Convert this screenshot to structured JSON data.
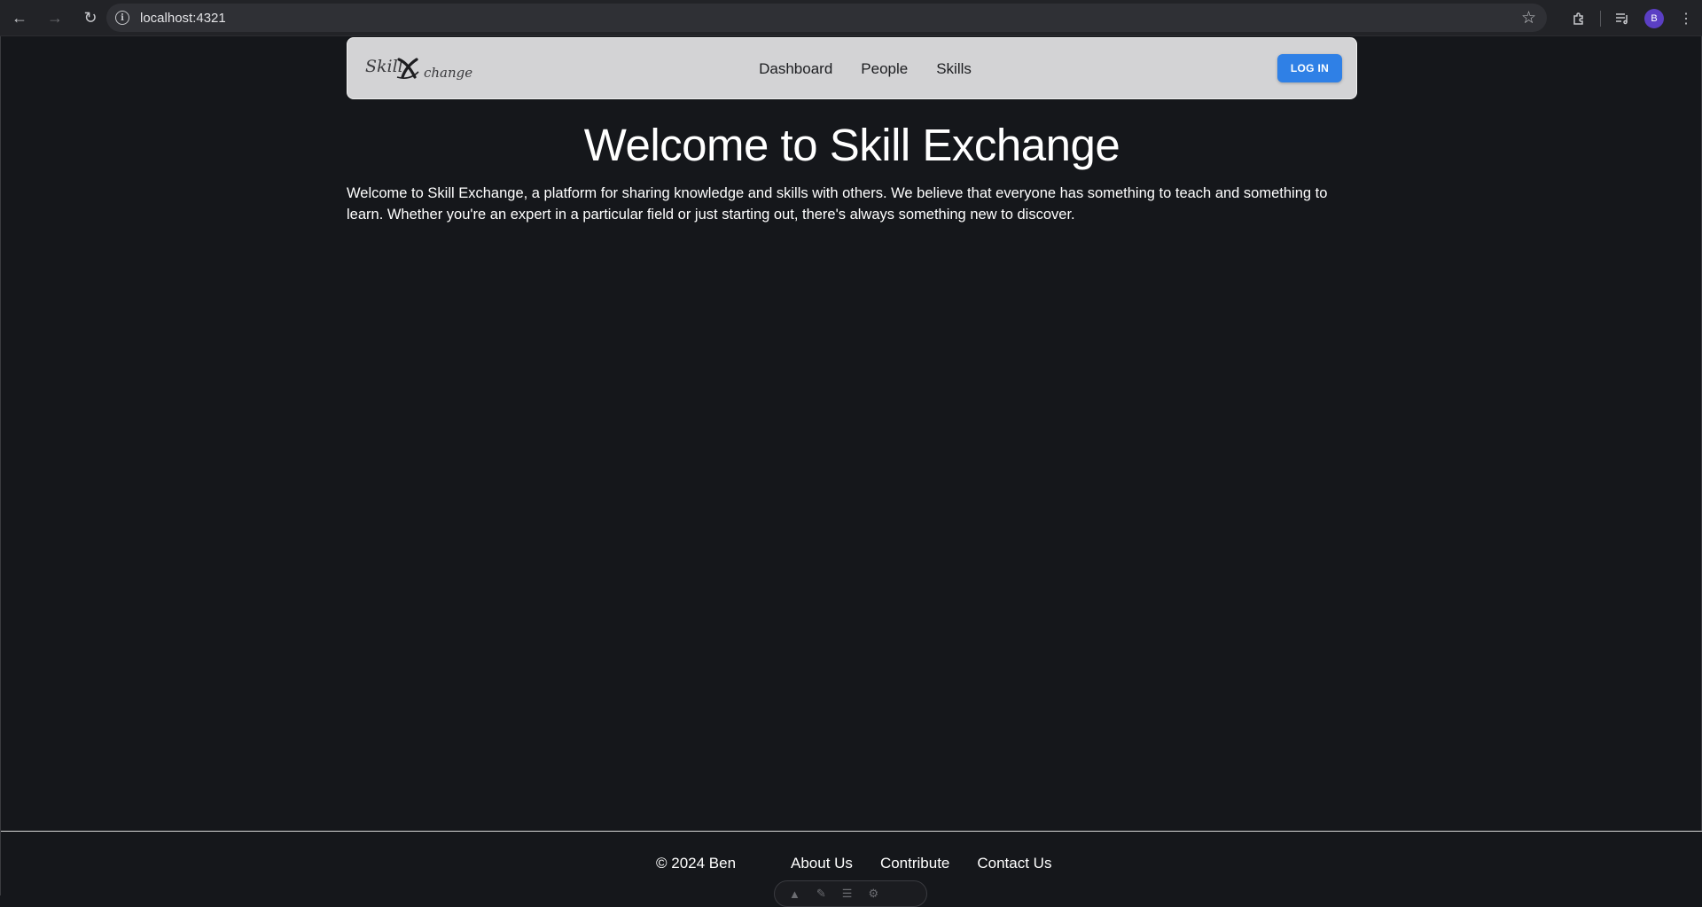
{
  "browser": {
    "url": "localhost:4321",
    "profile_initial": "B",
    "icons": {
      "back": "arrow-left-icon",
      "forward": "arrow-right-icon",
      "reload": "reload-icon",
      "site_info": "info-icon",
      "bookmark": "star-icon",
      "extensions": "puzzle-icon",
      "media": "media-control-icon",
      "menu": "kebab-menu-icon"
    }
  },
  "header": {
    "logo_text": "Skill Xchange",
    "nav": [
      "Dashboard",
      "People",
      "Skills"
    ],
    "login_label": "LOG IN"
  },
  "main": {
    "title": "Welcome to Skill Exchange",
    "intro": "Welcome to Skill Exchange, a platform for sharing knowledge and skills with others. We believe that everyone has something to teach and something to learn. Whether you're an expert in a particular field or just starting out, there's always something new to discover."
  },
  "footer": {
    "copyright": "© 2024 Ben",
    "links": [
      "About Us",
      "Contribute",
      "Contact Us"
    ]
  },
  "colors": {
    "page_bg": "#15171b",
    "navbar_bg": "#d3d3d5",
    "login_button": "#2f80e6",
    "text": "#ffffff"
  }
}
